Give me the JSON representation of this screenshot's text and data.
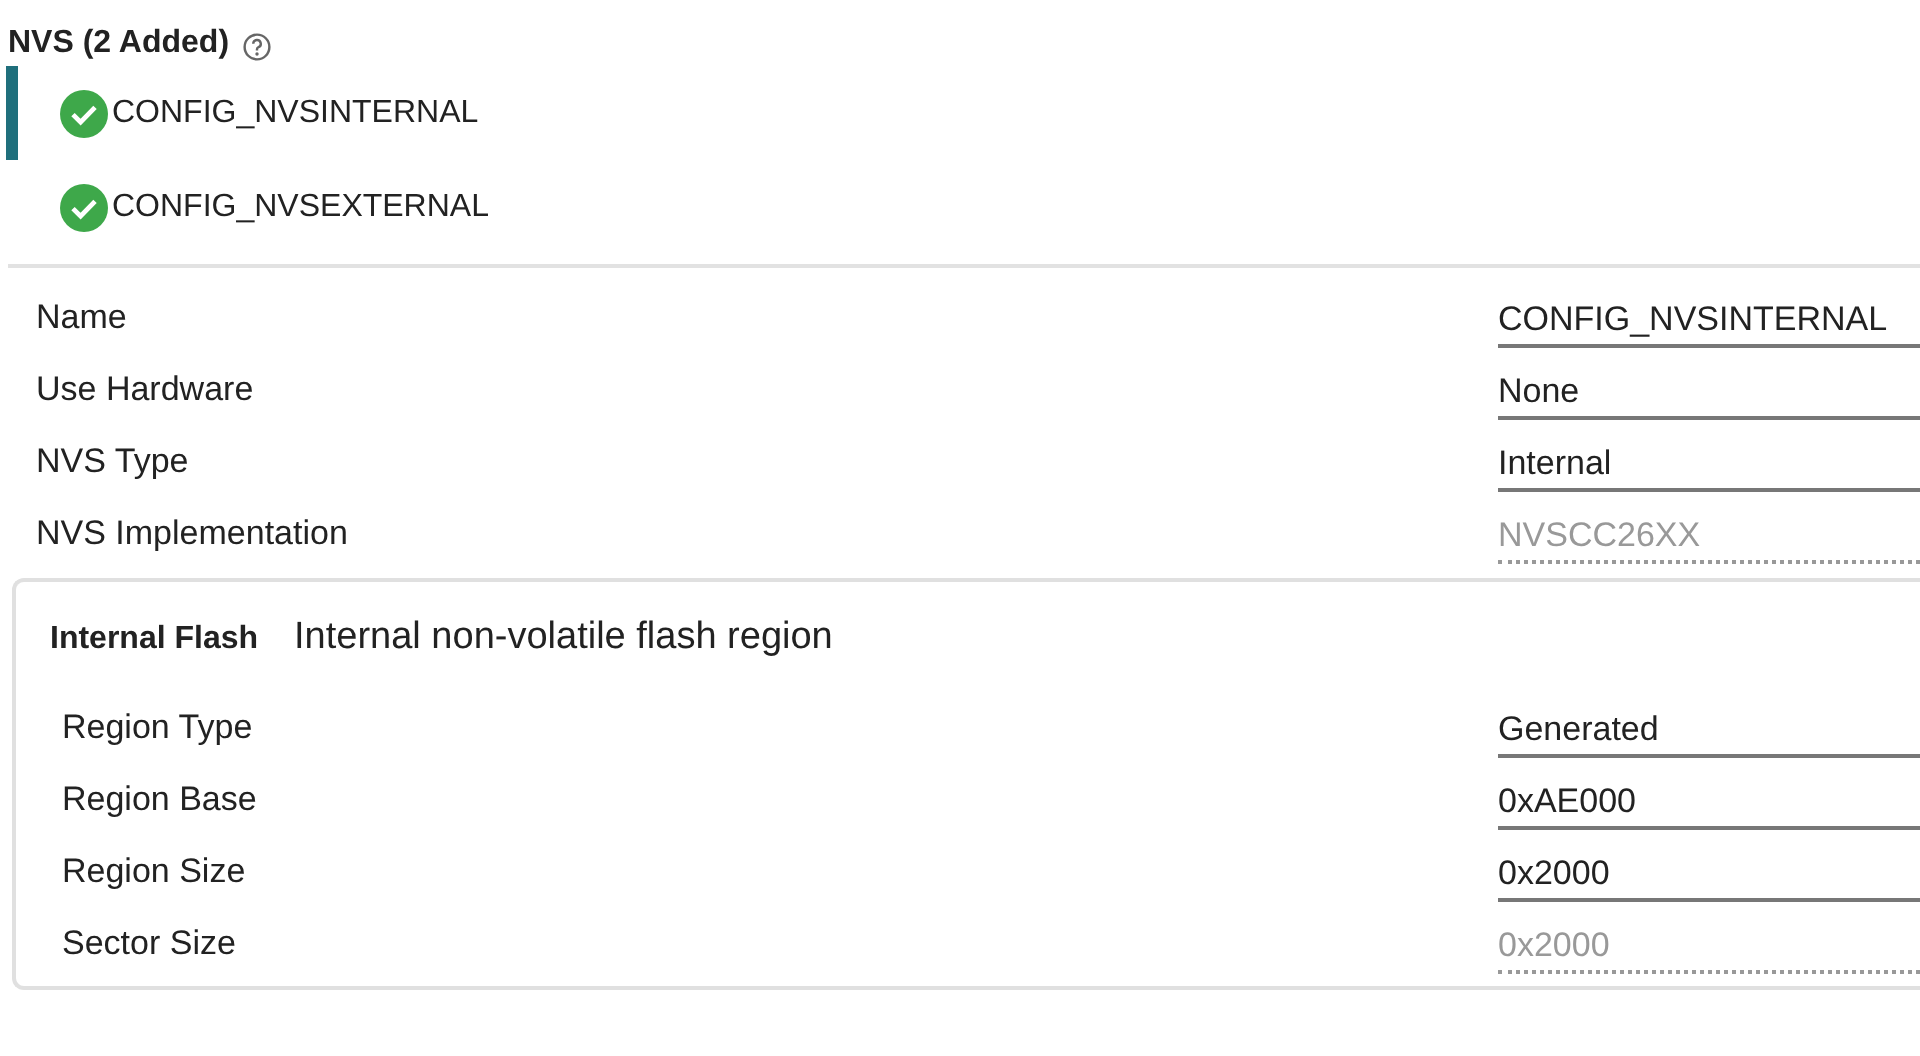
{
  "header": {
    "title": "NVS (2 Added)"
  },
  "instances": [
    {
      "name": "CONFIG_NVSINTERNAL",
      "selected": true,
      "valid": true
    },
    {
      "name": "CONFIG_NVSEXTERNAL",
      "selected": false,
      "valid": true
    }
  ],
  "properties": [
    {
      "label": "Name",
      "value": "CONFIG_NVSINTERNAL",
      "disabled": false
    },
    {
      "label": "Use Hardware",
      "value": "None",
      "disabled": false
    },
    {
      "label": "NVS Type",
      "value": "Internal",
      "disabled": false
    },
    {
      "label": "NVS Implementation",
      "value": "NVSCC26XX",
      "disabled": true
    }
  ],
  "group": {
    "title": "Internal Flash",
    "description": "Internal non-volatile flash region",
    "properties": [
      {
        "label": "Region Type",
        "value": "Generated",
        "disabled": false
      },
      {
        "label": "Region Base",
        "value": "0xAE000",
        "disabled": false
      },
      {
        "label": "Region Size",
        "value": "0x2000",
        "disabled": false
      },
      {
        "label": "Sector Size",
        "value": "0x2000",
        "disabled": true
      }
    ]
  }
}
